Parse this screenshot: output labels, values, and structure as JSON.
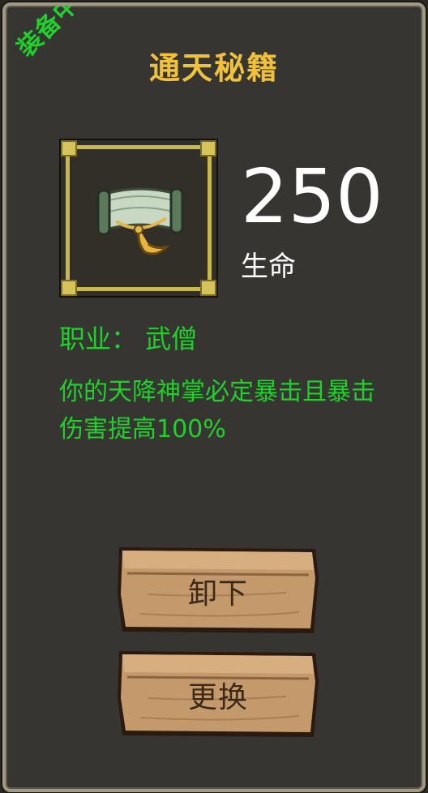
{
  "badge": "装备中",
  "item": {
    "name": "通天秘籍",
    "icon": "scroll-icon",
    "stat_value": "250",
    "stat_label": "生命",
    "job_line": "职业： 武僧",
    "description": "你的天降神掌必定暴击且暴击伤害提高100%"
  },
  "buttons": {
    "unequip": "卸下",
    "change": "更换"
  },
  "colors": {
    "title": "#f0c23a",
    "green_text": "#1fd12a",
    "frame_gold": "#c9b94c",
    "panel_bg": "#363532",
    "wood": "#c49a6c"
  }
}
